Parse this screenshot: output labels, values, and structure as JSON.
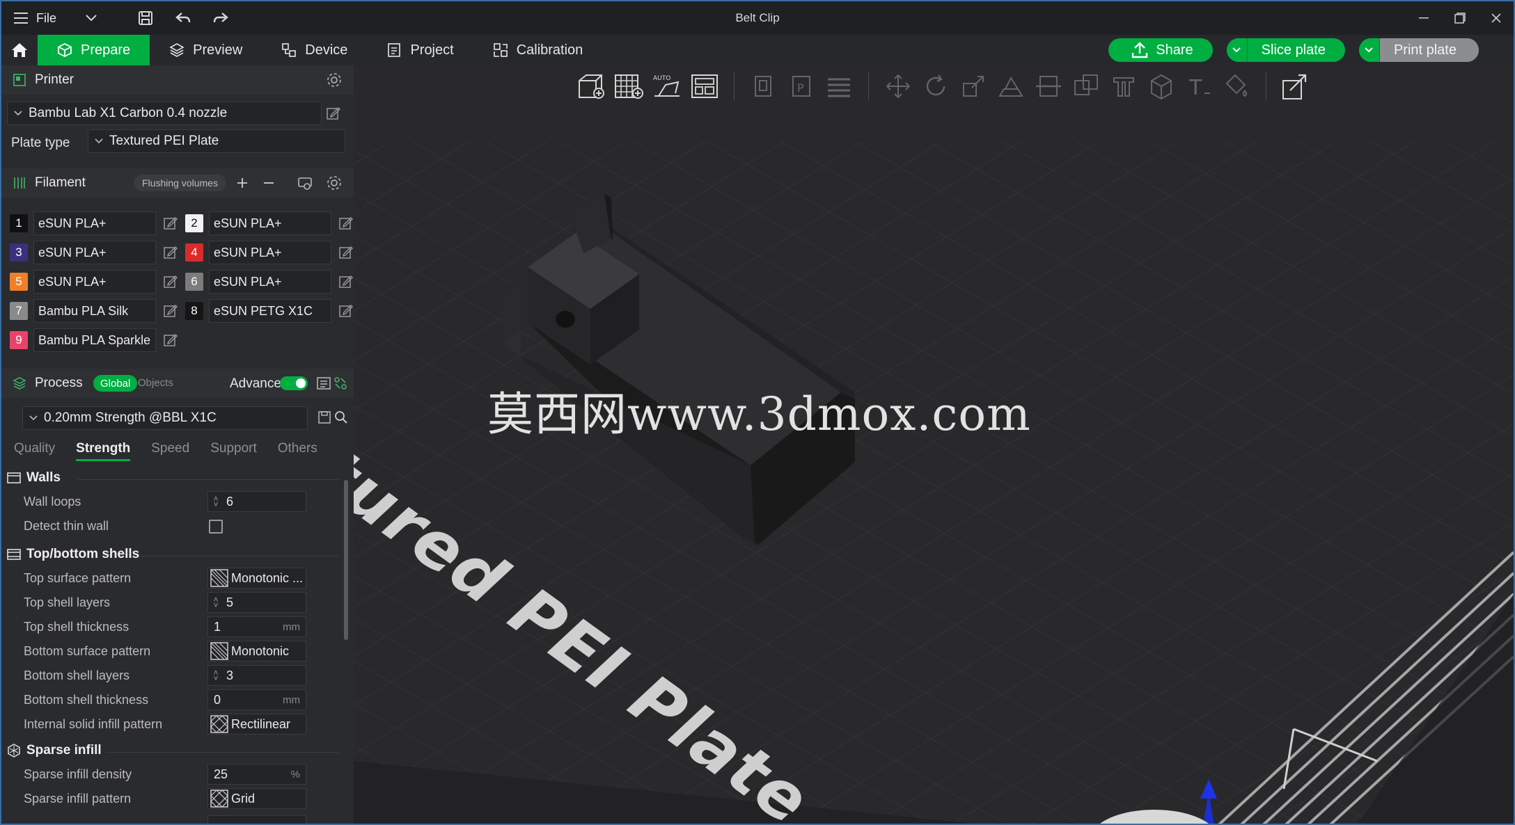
{
  "window": {
    "title": "Belt Clip",
    "file_menu": "File"
  },
  "tabs": [
    {
      "label": "Prepare",
      "active": true
    },
    {
      "label": "Preview"
    },
    {
      "label": "Device"
    },
    {
      "label": "Project"
    },
    {
      "label": "Calibration"
    }
  ],
  "actions": {
    "share": "Share",
    "slice": "Slice plate",
    "print": "Print plate"
  },
  "printer": {
    "section_title": "Printer",
    "selected": "Bambu Lab X1 Carbon 0.4 nozzle",
    "plate_type_label": "Plate type",
    "plate_type": "Textured PEI Plate"
  },
  "filament": {
    "section_title": "Filament",
    "flushing_label": "Flushing volumes",
    "items": [
      {
        "num": "1",
        "name": "eSUN PLA+",
        "color": "#111111"
      },
      {
        "num": "2",
        "name": "eSUN PLA+",
        "color": "#f2f2f2"
      },
      {
        "num": "3",
        "name": "eSUN PLA+",
        "color": "#3b2f7f"
      },
      {
        "num": "4",
        "name": "eSUN PLA+",
        "color": "#d92b2b"
      },
      {
        "num": "5",
        "name": "eSUN PLA+",
        "color": "#f07f2a"
      },
      {
        "num": "6",
        "name": "eSUN PLA+",
        "color": "#7c7c7c"
      },
      {
        "num": "7",
        "name": "Bambu PLA Silk",
        "color": "#8a8a8a"
      },
      {
        "num": "8",
        "name": "eSUN PETG X1C",
        "color": "#151515"
      },
      {
        "num": "9",
        "name": "Bambu PLA Sparkle",
        "color": "#e9436a"
      }
    ]
  },
  "process": {
    "section_title": "Process",
    "toggle_global": "Global",
    "toggle_objects": "Objects",
    "advance_label": "Advance",
    "preset": "0.20mm Strength @BBL X1C",
    "subtabs": [
      "Quality",
      "Strength",
      "Speed",
      "Support",
      "Others"
    ],
    "active_subtab": "Strength"
  },
  "settings": {
    "walls": {
      "title": "Walls",
      "wall_loops_label": "Wall loops",
      "wall_loops": "6",
      "detect_thin_wall_label": "Detect thin wall"
    },
    "shells": {
      "title": "Top/bottom shells",
      "top_surface_pattern_label": "Top surface pattern",
      "top_surface_pattern": "Monotonic ...",
      "top_shell_layers_label": "Top shell layers",
      "top_shell_layers": "5",
      "top_shell_thickness_label": "Top shell thickness",
      "top_shell_thickness": "1",
      "bottom_surface_pattern_label": "Bottom surface pattern",
      "bottom_surface_pattern": "Monotonic",
      "bottom_shell_layers_label": "Bottom shell layers",
      "bottom_shell_layers": "3",
      "bottom_shell_thickness_label": "Bottom shell thickness",
      "bottom_shell_thickness": "0",
      "internal_solid_label": "Internal solid infill pattern",
      "internal_solid": "Rectilinear",
      "unit_mm": "mm"
    },
    "infill": {
      "title": "Sparse infill",
      "density_label": "Sparse infill density",
      "density": "25",
      "density_unit": "%",
      "pattern_label": "Sparse infill pattern",
      "pattern": "Grid"
    }
  },
  "viewport": {
    "watermark": "莫西网www.3dmox.com",
    "plate_label": "tured PEI Plate"
  },
  "colors": {
    "accent": "#00ae42",
    "panel": "#2a2b2e",
    "viewport": "#262729"
  }
}
